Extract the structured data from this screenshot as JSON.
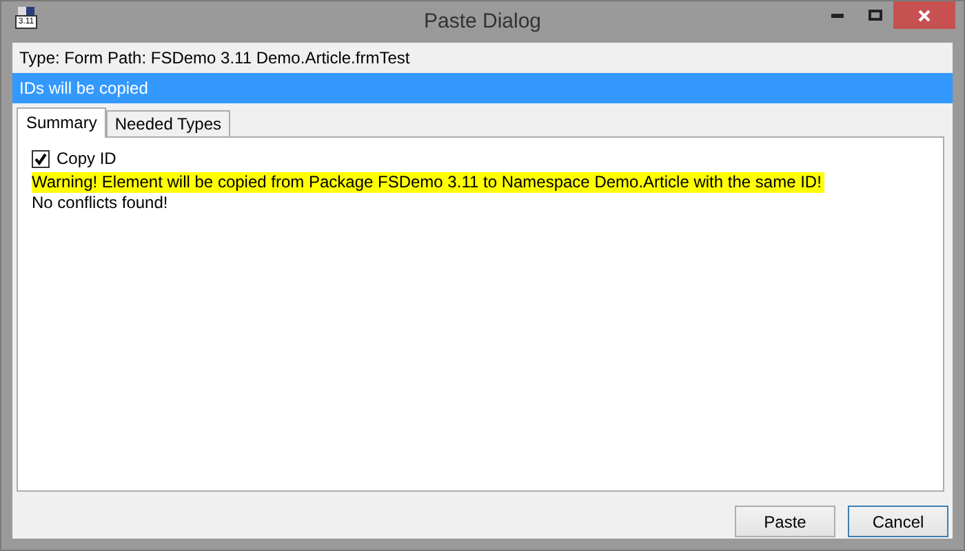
{
  "window": {
    "title": "Paste Dialog",
    "icon_label": "3.11"
  },
  "path_line": "Type: Form Path: FSDemo 3.11 Demo.Article.frmTest",
  "banner": "IDs will be copied",
  "tabs": [
    {
      "label": "Summary",
      "selected": true
    },
    {
      "label": "Needed Types",
      "selected": false
    }
  ],
  "copy_id": {
    "label": "Copy ID",
    "checked": true
  },
  "messages": [
    {
      "text": "Warning! Element will be copied from Package FSDemo 3.11 to Namespace Demo.Article with the same ID!",
      "highlighted": true
    },
    {
      "text": "No conflicts found!",
      "highlighted": false
    }
  ],
  "buttons": [
    {
      "label": "Paste",
      "focused": false
    },
    {
      "label": "Cancel",
      "focused": true
    }
  ]
}
